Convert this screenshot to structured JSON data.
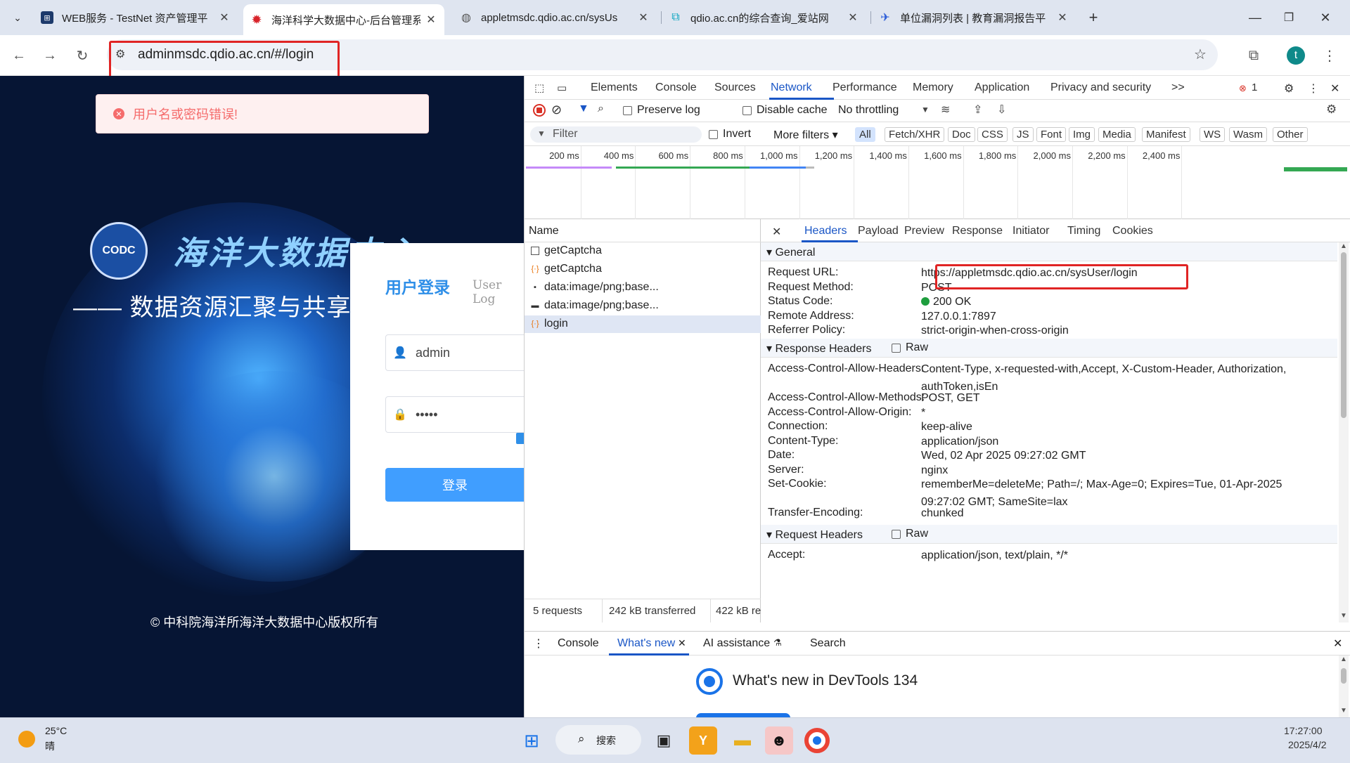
{
  "tabs": [
    {
      "title": "WEB服务 - TestNet 资产管理平",
      "icon": "network-icon"
    },
    {
      "title": "海洋科学大数据中心-后台管理系",
      "icon": "gear-icon"
    },
    {
      "title": "appletmsdc.qdio.ac.cn/sysUs",
      "icon": "globe-icon"
    },
    {
      "title": "qdio.ac.cn的综合查询_爱站网",
      "icon": "aizhan-icon"
    },
    {
      "title": "单位漏洞列表 | 教育漏洞报告平",
      "icon": "bird-icon"
    }
  ],
  "address": {
    "url": "adminmsdc.qdio.ac.cn/#/login",
    "profile_initial": "t"
  },
  "page": {
    "error_message": "用户名或密码错误!",
    "logo_text": "CODC",
    "site_title": "海洋大数据中心",
    "subtitle": "—— 数据资源汇聚与共享管理系统",
    "login_title": "用户登录",
    "login_subtitle": "User Log",
    "username_value": "admin",
    "password_value": "•••••",
    "login_button": "登录",
    "copyright": "© 中科院海洋所海洋大数据中心版权所有"
  },
  "devtools": {
    "tabs": [
      "Elements",
      "Console",
      "Sources",
      "Network",
      "Performance",
      "Memory",
      "Application",
      "Privacy and security"
    ],
    "more": ">>",
    "error_count": "1",
    "toolbar": {
      "preserve_log": "Preserve log",
      "disable_cache": "Disable cache",
      "throttling": "No throttling"
    },
    "filter": {
      "placeholder": "Filter",
      "invert": "Invert",
      "more_filters": "More filters ▾",
      "chips": [
        "All",
        "Fetch/XHR",
        "Doc",
        "CSS",
        "JS",
        "Font",
        "Img",
        "Media",
        "Manifest",
        "WS",
        "Wasm",
        "Other"
      ]
    },
    "timeline_ticks": [
      "200 ms",
      "400 ms",
      "600 ms",
      "800 ms",
      "1,000 ms",
      "1,200 ms",
      "1,400 ms",
      "1,600 ms",
      "1,800 ms",
      "2,000 ms",
      "2,200 ms",
      "2,400 ms"
    ],
    "name_header": "Name",
    "requests": [
      {
        "name": "getCaptcha",
        "type": "doc"
      },
      {
        "name": "getCaptcha",
        "type": "xhr"
      },
      {
        "name": "data:image/png;base...",
        "type": "img"
      },
      {
        "name": "data:image/png;base...",
        "type": "img"
      },
      {
        "name": "login",
        "type": "xhr"
      }
    ],
    "status": {
      "requests": "5 requests",
      "transferred": "242 kB transferred",
      "resources": "422 kB re"
    },
    "detail_tabs": [
      "Headers",
      "Payload",
      "Preview",
      "Response",
      "Initiator",
      "Timing",
      "Cookies"
    ],
    "general": {
      "title": "General",
      "rows": [
        {
          "k": "Request URL:",
          "v": "https://appletmsdc.qdio.ac.cn/sysUser/login"
        },
        {
          "k": "Request Method:",
          "v": "POST"
        },
        {
          "k": "Status Code:",
          "v": "200 OK"
        },
        {
          "k": "Remote Address:",
          "v": "127.0.0.1:7897"
        },
        {
          "k": "Referrer Policy:",
          "v": "strict-origin-when-cross-origin"
        }
      ]
    },
    "response_headers": {
      "title": "Response Headers",
      "raw": "Raw",
      "rows": [
        {
          "k": "Access-Control-Allow-Headers:",
          "v": "Content-Type, x-requested-with,Accept, X-Custom-Header, Authorization, authToken,isEn"
        },
        {
          "k": "Access-Control-Allow-Methods:",
          "v": "POST, GET"
        },
        {
          "k": "Access-Control-Allow-Origin:",
          "v": "*"
        },
        {
          "k": "Connection:",
          "v": "keep-alive"
        },
        {
          "k": "Content-Type:",
          "v": "application/json"
        },
        {
          "k": "Date:",
          "v": "Wed, 02 Apr 2025 09:27:02 GMT"
        },
        {
          "k": "Server:",
          "v": "nginx"
        },
        {
          "k": "Set-Cookie:",
          "v": "rememberMe=deleteMe; Path=/; Max-Age=0; Expires=Tue, 01-Apr-2025 09:27:02 GMT; SameSite=lax"
        },
        {
          "k": "Transfer-Encoding:",
          "v": "chunked"
        }
      ]
    },
    "request_headers": {
      "title": "Request Headers",
      "raw": "Raw",
      "rows": [
        {
          "k": "Accept:",
          "v": "application/json, text/plain, */*"
        }
      ]
    },
    "drawer": {
      "tabs": [
        "Console",
        "What's new",
        "AI assistance",
        "Search"
      ],
      "headline": "What's new in DevTools 134"
    }
  },
  "taskbar": {
    "temp": "25°C",
    "weather": "晴",
    "search": "搜索",
    "time": "17:27:00",
    "date": "2025/4/2"
  },
  "colors": {
    "accent": "#1a56c6",
    "error": "#f56c6c",
    "highlight": "#e02424",
    "status_ok": "#1e9e3e"
  }
}
